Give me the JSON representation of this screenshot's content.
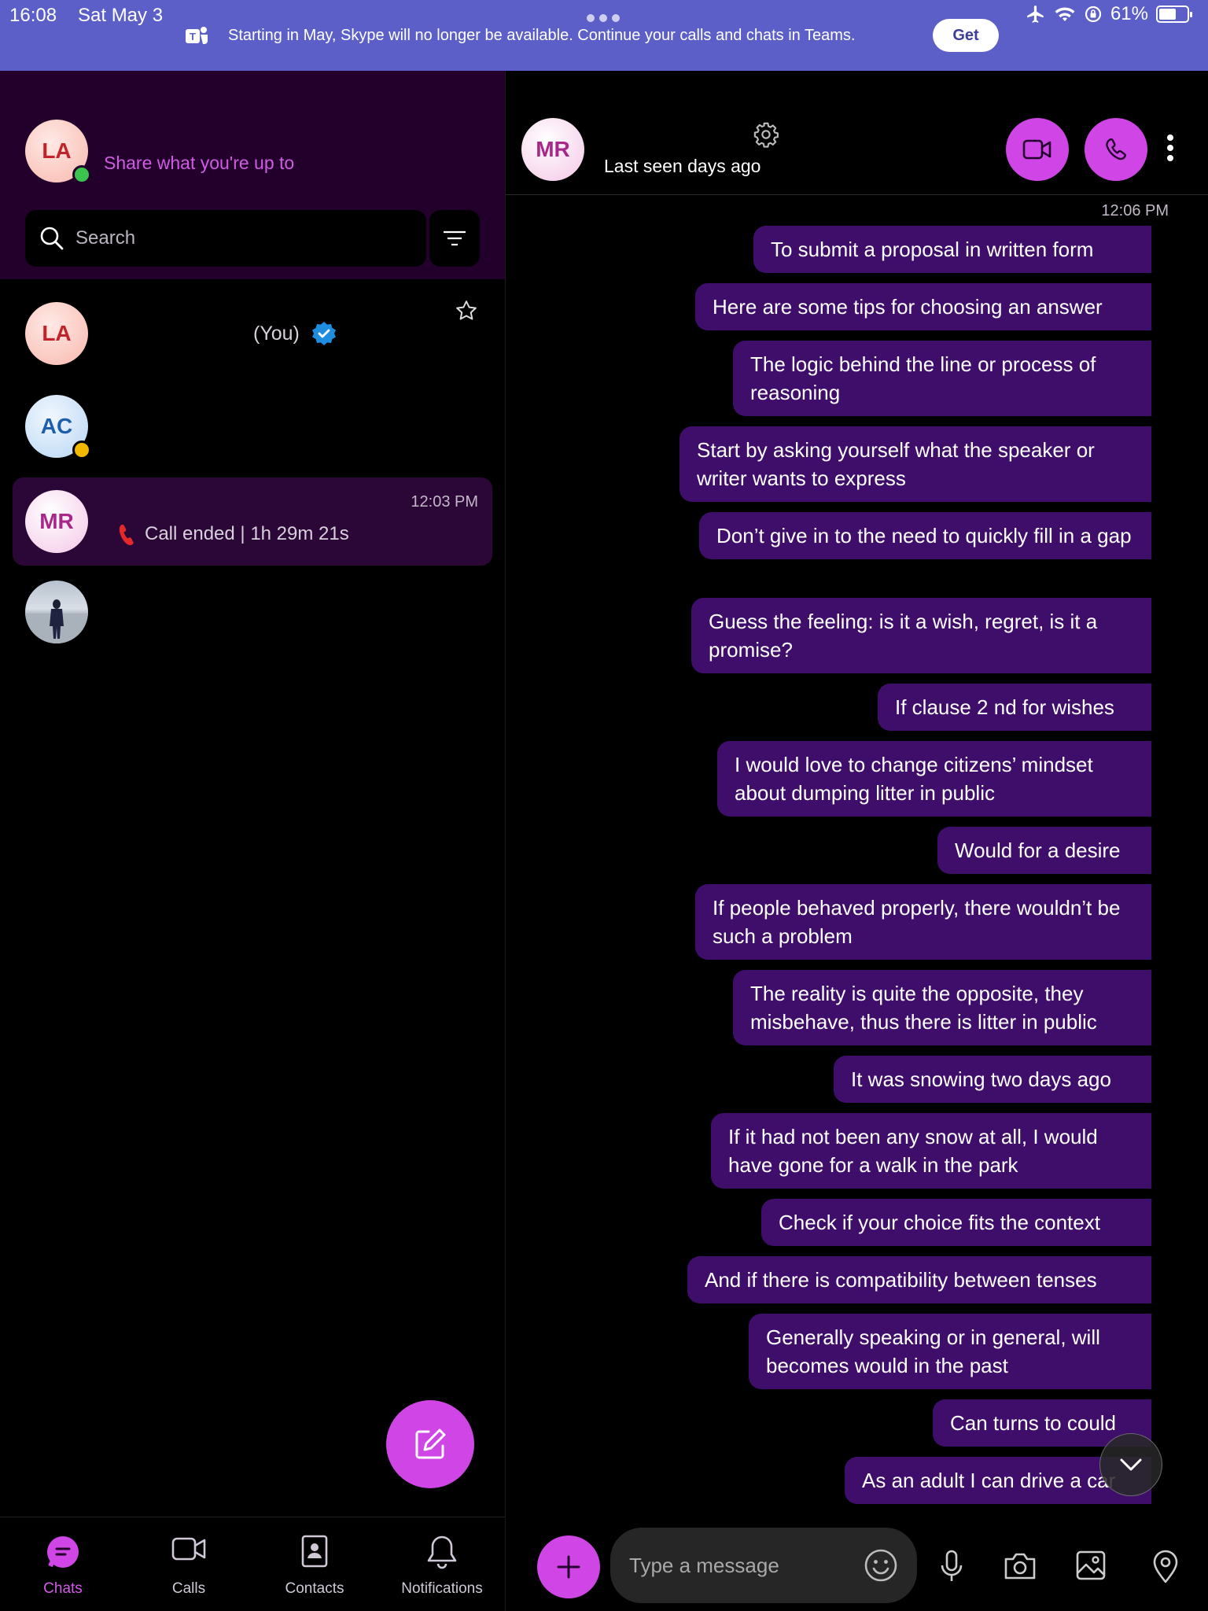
{
  "status_bar": {
    "time": "16:08",
    "date": "Sat May 3",
    "battery": "61%",
    "battery_level": 0.61
  },
  "banner": {
    "text": "Starting in May, Skype will no longer be available. Continue your calls and chats in Teams.",
    "button": "Get"
  },
  "profile": {
    "initials": "LA",
    "share_prompt": "Share what you're up to"
  },
  "search": {
    "placeholder": "Search"
  },
  "chats": [
    {
      "initials": "LA",
      "name_suffix": "(You)",
      "verified": true,
      "favorite": false
    },
    {
      "initials": "AC",
      "presence": "away"
    },
    {
      "initials": "MR",
      "time": "12:03 PM",
      "preview": "Call ended | 1h 29m 21s",
      "selected": true
    },
    {
      "initials": "",
      "photo": "person-in-snow-photo"
    }
  ],
  "nav": {
    "chats": "Chats",
    "calls": "Calls",
    "contacts": "Contacts",
    "notifications": "Notifications"
  },
  "conversation": {
    "initials": "MR",
    "last_seen": "Last seen days ago",
    "time": "12:06 PM",
    "messages": [
      "To submit a proposal in written form",
      "Here are some tips for choosing an answer",
      "The logic behind the line or process of reasoning",
      "Start by asking yourself what the speaker or writer wants to express",
      "Don’t give in to the need to quickly fill in a gap",
      "Guess the feeling: is it a wish, regret, is it a promise?",
      "If clause 2 nd for wishes",
      "I would love to change citizens’ mindset about dumping litter in public",
      "Would for a desire",
      "If people behaved properly, there wouldn’t be such a problem",
      "The reality is quite the opposite, they misbehave, thus there is litter in public",
      "It was snowing two days ago",
      "If it had not been any snow at all, I would have gone for a walk in the park",
      "Check if your choice fits the context",
      "And if there is compatibility between tenses",
      "Generally speaking or in general, will becomes would in the past",
      "Can turns to could",
      "As an adult I can drive a car"
    ]
  },
  "composer": {
    "placeholder": "Type a message"
  },
  "colors": {
    "accent": "#d045e6",
    "bubble": "#3f0e6b",
    "banner": "#5b5fc7",
    "sidebar_header": "#22002b"
  }
}
